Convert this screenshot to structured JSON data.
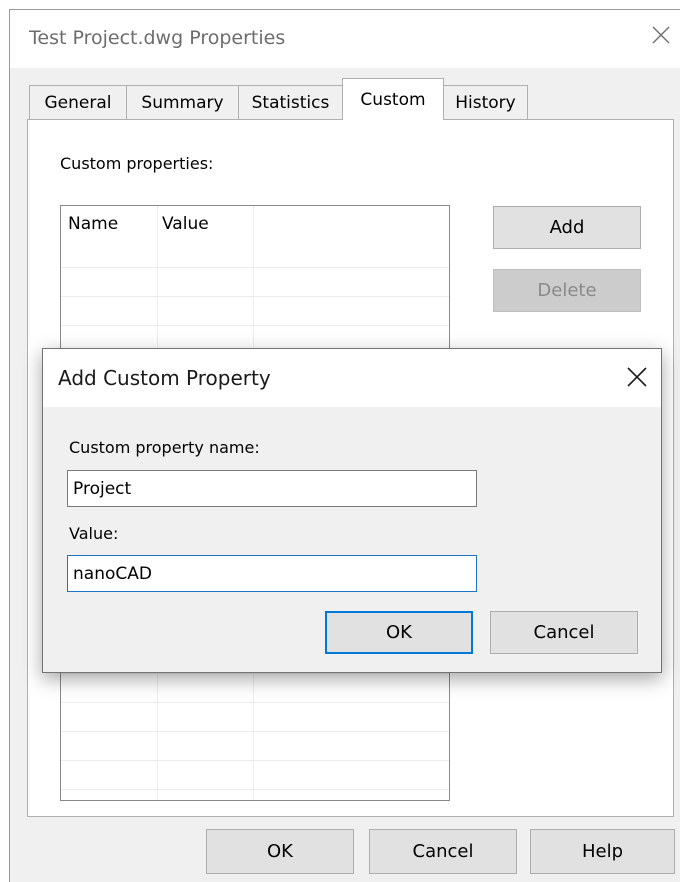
{
  "window": {
    "title": "Test Project.dwg Properties",
    "tabs": [
      {
        "label": "General"
      },
      {
        "label": "Summary"
      },
      {
        "label": "Statistics"
      },
      {
        "label": "Custom",
        "active": true
      },
      {
        "label": "History"
      }
    ],
    "custom_tab": {
      "section_label": "Custom properties:",
      "grid_headers": [
        "Name",
        "Value"
      ],
      "add_label": "Add",
      "delete_label": "Delete"
    },
    "buttons": {
      "ok": "OK",
      "cancel": "Cancel",
      "help": "Help"
    }
  },
  "dialog": {
    "title": "Add Custom Property",
    "name_label": "Custom property name:",
    "name_value": "Project",
    "value_label": "Value:",
    "value_value": "nanoCAD",
    "ok_label": "OK",
    "cancel_label": "Cancel"
  },
  "icons": {
    "close": "close-icon"
  },
  "colors": {
    "focus_border": "#0078d7",
    "disabled_button": "#cccccc"
  }
}
